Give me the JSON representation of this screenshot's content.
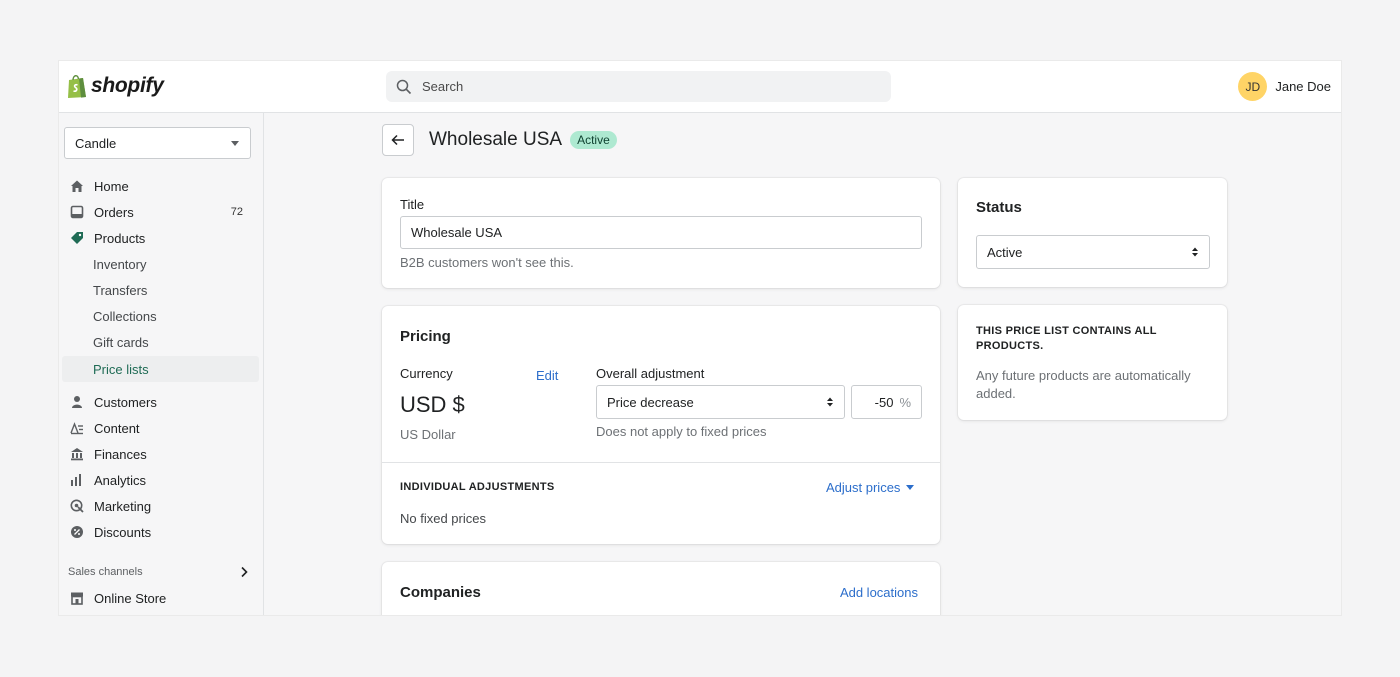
{
  "brand": {
    "name": "shopify",
    "accent": "#95bf47"
  },
  "search": {
    "placeholder": "Search"
  },
  "user": {
    "initials": "JD",
    "name": "Jane Doe"
  },
  "sidebar": {
    "store": "Candle",
    "items": [
      {
        "label": "Home",
        "icon": "home-icon"
      },
      {
        "label": "Orders",
        "icon": "orders-icon",
        "badge": "72"
      },
      {
        "label": "Products",
        "icon": "tag-icon"
      },
      {
        "label": "Inventory",
        "sub": true
      },
      {
        "label": "Transfers",
        "sub": true
      },
      {
        "label": "Collections",
        "sub": true
      },
      {
        "label": "Gift cards",
        "sub": true
      },
      {
        "label": "Price lists",
        "sub": true,
        "active": true
      },
      {
        "label": "Customers",
        "icon": "person-icon"
      },
      {
        "label": "Content",
        "icon": "content-icon"
      },
      {
        "label": "Finances",
        "icon": "bank-icon"
      },
      {
        "label": "Analytics",
        "icon": "bar-chart-icon"
      },
      {
        "label": "Marketing",
        "icon": "target-icon"
      },
      {
        "label": "Discounts",
        "icon": "discount-icon"
      }
    ],
    "sales_channels_label": "Sales channels",
    "online_store": "Online Store"
  },
  "page": {
    "title": "Wholesale USA",
    "status": "Active"
  },
  "title_card": {
    "label": "Title",
    "value": "Wholesale USA",
    "help": "B2B customers won't see this."
  },
  "pricing": {
    "heading": "Pricing",
    "currency_label": "Currency",
    "edit": "Edit",
    "currency_code": "USD $",
    "currency_name": "US Dollar",
    "adjustment_label": "Overall adjustment",
    "adjustment_type": "Price decrease",
    "adjustment_value": "-50",
    "adjustment_unit": "%",
    "adjustment_help": "Does not apply to fixed prices",
    "individual_label": "INDIVIDUAL ADJUSTMENTS",
    "adjust_prices": "Adjust prices",
    "no_fixed": "No fixed prices"
  },
  "companies": {
    "heading": "Companies",
    "add_locations": "Add locations"
  },
  "status_card": {
    "heading": "Status",
    "value": "Active"
  },
  "info_card": {
    "heading": "THIS PRICE LIST CONTAINS ALL PRODUCTS.",
    "body": "Any future products are automatically added."
  }
}
